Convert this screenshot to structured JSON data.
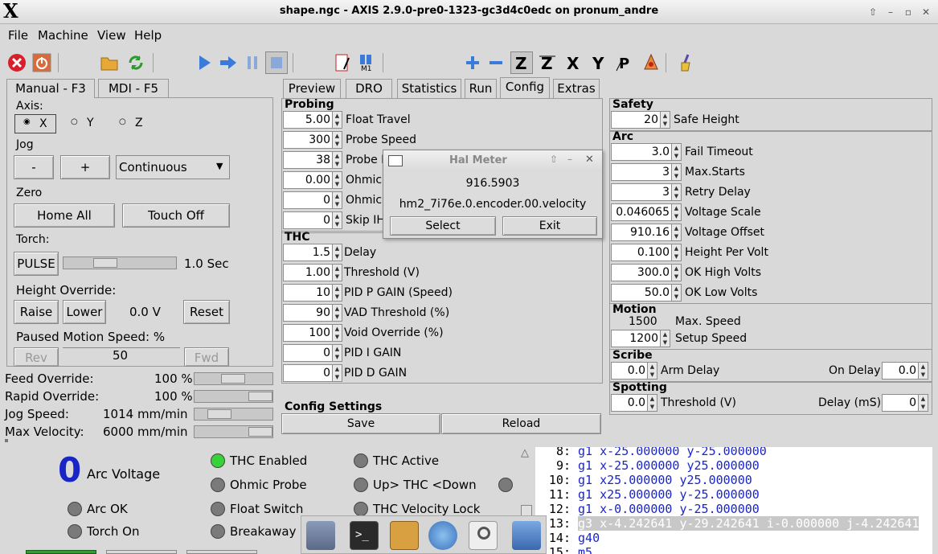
{
  "window": {
    "title": "shape.ngc - AXIS 2.9.0-pre0-1323-gc3d4c0edc on pronum_andre"
  },
  "menu": {
    "file": "File",
    "machine": "Machine",
    "view": "View",
    "help": "Help"
  },
  "left_tabs": {
    "manual": "Manual - F3",
    "mdi": "MDI - F5"
  },
  "axis": {
    "label": "Axis:",
    "x": "X",
    "y": "Y",
    "z": "Z"
  },
  "jog": {
    "label": "Jog",
    "minus": "-",
    "plus": "+",
    "mode": "Continuous"
  },
  "zero": {
    "label": "Zero",
    "home_all": "Home All",
    "touch_off": "Touch Off"
  },
  "torch": {
    "label": "Torch:",
    "pulse": "PULSE",
    "time": "1.0 Sec"
  },
  "height": {
    "label": "Height Override:",
    "raise": "Raise",
    "lower": "Lower",
    "value": "0.0 V",
    "reset": "Reset"
  },
  "paused": {
    "label": "Paused Motion Speed: %",
    "rev": "Rev",
    "value": "50",
    "fwd": "Fwd"
  },
  "overrides": {
    "feed_label": "Feed Override:",
    "feed_value": "100 %",
    "rapid_label": "Rapid Override:",
    "rapid_value": "100 %",
    "jog_label": "Jog Speed:",
    "jog_value": "1014 mm/min",
    "maxvel_label": "Max Velocity:",
    "maxvel_value": "6000 mm/min"
  },
  "right_tabs": [
    "Preview",
    "DRO",
    "Statistics",
    "Run",
    "Config",
    "Extras"
  ],
  "probing": {
    "title": "Probing",
    "rows": [
      {
        "v": "5.00",
        "l": "Float Travel"
      },
      {
        "v": "300",
        "l": "Probe Speed"
      },
      {
        "v": "38",
        "l": "Probe H"
      },
      {
        "v": "0.00",
        "l": "Ohmic"
      },
      {
        "v": "0",
        "l": "Ohmic"
      },
      {
        "v": "0",
        "l": "Skip IH"
      }
    ]
  },
  "thc": {
    "title": "THC",
    "rows": [
      {
        "v": "1.5",
        "l": "Delay"
      },
      {
        "v": "1.00",
        "l": "Threshold (V)"
      },
      {
        "v": "10",
        "l": "PID P GAIN (Speed)"
      },
      {
        "v": "90",
        "l": "VAD Threshold (%)"
      },
      {
        "v": "100",
        "l": "Void Override (%)"
      },
      {
        "v": "0",
        "l": "PID I GAIN"
      },
      {
        "v": "0",
        "l": "PID D GAIN"
      }
    ]
  },
  "config_settings": {
    "title": "Config Settings",
    "save": "Save",
    "reload": "Reload"
  },
  "safety": {
    "title": "Safety",
    "value": "20",
    "label": "Safe Height"
  },
  "arc": {
    "title": "Arc",
    "rows": [
      {
        "v": "3.0",
        "l": "Fail Timeout"
      },
      {
        "v": "3",
        "l": "Max.Starts"
      },
      {
        "v": "3",
        "l": "Retry Delay"
      },
      {
        "v": "0.046065",
        "l": "Voltage Scale"
      },
      {
        "v": "910.16",
        "l": "Voltage Offset"
      },
      {
        "v": "0.100",
        "l": "Height Per Volt"
      },
      {
        "v": "300.0",
        "l": "OK High Volts"
      },
      {
        "v": "50.0",
        "l": "OK Low Volts"
      }
    ]
  },
  "motion": {
    "title": "Motion",
    "max_value": "1500",
    "max_label": "Max. Speed",
    "setup_value": "1200",
    "setup_label": "Setup Speed"
  },
  "scribe": {
    "title": "Scribe",
    "arm_value": "0.0",
    "arm_label": "Arm Delay",
    "on_label": "On Delay",
    "on_value": "0.0"
  },
  "spotting": {
    "title": "Spotting",
    "thr_value": "0.0",
    "thr_label": "Threshold (V)",
    "delay_label": "Delay (mS)",
    "delay_value": "0"
  },
  "halmeter": {
    "title": "Hal Meter",
    "value": "916.5903",
    "pin": "hm2_7i76e.0.encoder.00.velocity",
    "select": "Select",
    "exit": "Exit"
  },
  "status": {
    "arc_voltage_value": "0",
    "arc_voltage_label": "Arc Voltage",
    "arc_ok": "Arc OK",
    "torch_on": "Torch On",
    "thc_enabled": "THC Enabled",
    "ohmic_probe": "Ohmic Probe",
    "float_switch": "Float Switch",
    "breakaway": "Breakaway",
    "thc_active": "THC Active",
    "updown": "Up> THC <Down",
    "thc_vel_lock": "THC Velocity Lock"
  },
  "gcode": [
    {
      "n": "8:",
      "c": "g1 x-25.000000 y-25.000000"
    },
    {
      "n": "9:",
      "c": "g1 x-25.000000 y25.000000"
    },
    {
      "n": "10:",
      "c": "g1 x25.000000 y25.000000"
    },
    {
      "n": "11:",
      "c": "g1 x25.000000 y-25.000000"
    },
    {
      "n": "12:",
      "c": "g1 x-0.000000 y-25.000000"
    },
    {
      "n": "13:",
      "c": "g3 x-4.242641 y-29.242641 i-0.000000 j-4.242641"
    },
    {
      "n": "14:",
      "c": "g40"
    },
    {
      "n": "15:",
      "c": "m5"
    }
  ]
}
